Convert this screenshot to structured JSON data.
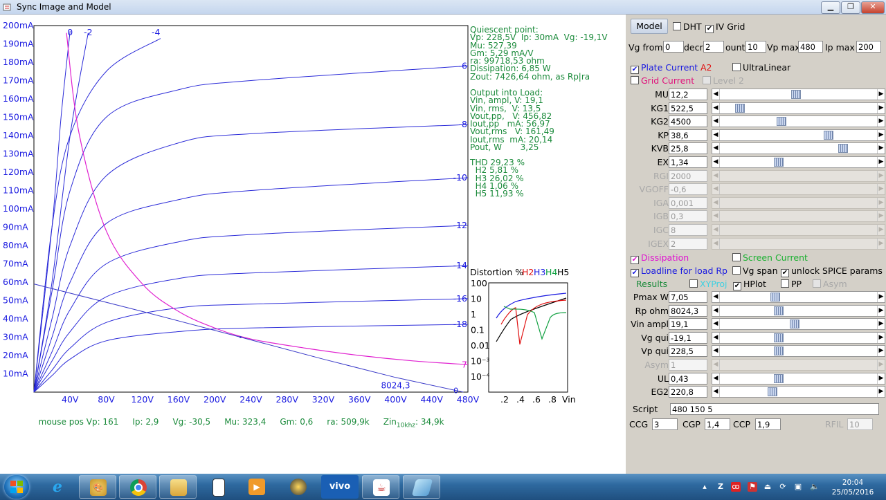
{
  "window": {
    "title": "Sync Image and Model",
    "buttons": {
      "minimize": "▁",
      "maximize": "❐",
      "close": "✕"
    }
  },
  "chart_data": {
    "type": "line",
    "title": "",
    "xlabel": "",
    "ylabel": "",
    "xlim": [
      0,
      480
    ],
    "ylim": [
      0,
      200
    ],
    "x_ticks": [
      "40V",
      "80V",
      "120V",
      "160V",
      "200V",
      "240V",
      "280V",
      "320V",
      "360V",
      "400V",
      "440V",
      "480V"
    ],
    "y_ticks": [
      "10mA",
      "20mA",
      "30mA",
      "40mA",
      "50mA",
      "60mA",
      "70mA",
      "80mA",
      "90mA",
      "100mA",
      "110mA",
      "120mA",
      "130mA",
      "140mA",
      "150mA",
      "160mA",
      "170mA",
      "180mA",
      "190mA",
      "200mA"
    ],
    "grid": false,
    "colors": {
      "curves": "#2a2ad8",
      "dissipation": "#e020d0",
      "loadline": "#3a3ac8"
    },
    "series": [
      {
        "name": "0",
        "x": [
          0,
          20,
          30,
          40
        ],
        "y": [
          0,
          90,
          150,
          197
        ]
      },
      {
        "name": "-2",
        "x": [
          0,
          20,
          40,
          60
        ],
        "y": [
          0,
          60,
          140,
          196
        ]
      },
      {
        "name": "-4",
        "x": [
          0,
          20,
          40,
          80,
          140
        ],
        "y": [
          0,
          90,
          140,
          175,
          193
        ]
      },
      {
        "name": "-6",
        "x": [
          0,
          20,
          40,
          80,
          160,
          240,
          480
        ],
        "y": [
          0,
          55,
          110,
          150,
          165,
          170,
          178
        ]
      },
      {
        "name": "-8",
        "x": [
          0,
          20,
          40,
          80,
          160,
          240,
          480
        ],
        "y": [
          0,
          40,
          80,
          118,
          136,
          141,
          146
        ]
      },
      {
        "name": "-10",
        "x": [
          0,
          20,
          40,
          80,
          160,
          240,
          480
        ],
        "y": [
          0,
          30,
          60,
          92,
          105,
          110,
          117
        ]
      },
      {
        "name": "-12",
        "x": [
          0,
          20,
          40,
          80,
          160,
          240,
          480
        ],
        "y": [
          0,
          22,
          45,
          70,
          82,
          86,
          91
        ]
      },
      {
        "name": "-14",
        "x": [
          0,
          20,
          40,
          80,
          160,
          240,
          480
        ],
        "y": [
          0,
          17,
          33,
          52,
          62,
          65,
          69
        ]
      },
      {
        "name": "-16",
        "x": [
          0,
          20,
          40,
          80,
          160,
          240,
          480
        ],
        "y": [
          0,
          12,
          24,
          38,
          46,
          48,
          51
        ]
      },
      {
        "name": "-18",
        "x": [
          0,
          20,
          40,
          80,
          160,
          240,
          480
        ],
        "y": [
          0,
          9,
          18,
          28,
          33,
          35,
          37
        ]
      }
    ],
    "dissipation": {
      "x": [
        36,
        50,
        80,
        120,
        160,
        200,
        240,
        300,
        360,
        420,
        480
      ],
      "y": [
        196,
        141,
        88,
        59,
        44,
        35,
        29,
        24,
        20,
        17,
        15
      ]
    },
    "loadline": {
      "x": [
        0,
        120,
        228.5,
        320,
        400,
        475
      ],
      "y": [
        59,
        44,
        30,
        18,
        8,
        0
      ],
      "label": "8024,3"
    },
    "curve_end_labels": [
      "-6",
      "-8",
      "-10",
      "-12",
      "-14",
      "-16",
      "-18"
    ],
    "dissipation_end_label": "7",
    "zero_label": "0",
    "top_labels": [
      "0",
      "-2",
      "-4"
    ],
    "quiescent": {
      "x": 228.5,
      "y": 30
    }
  },
  "distortion_chart": {
    "title": "Distortion %",
    "legend": [
      {
        "name": "H2",
        "color": "#e01010"
      },
      {
        "name": "H3",
        "color": "#1a1ae0"
      },
      {
        "name": "H4",
        "color": "#10a040"
      },
      {
        "name": "H5",
        "color": "#000000"
      }
    ],
    "y_ticks": [
      "100",
      "10",
      "1",
      "0.1",
      "0.01",
      "10⁻³",
      "10⁻⁴"
    ],
    "x_ticks": [
      ".2",
      ".4",
      ".6",
      ".8"
    ],
    "x_unit": "Vin"
  },
  "quiescent": {
    "heading": "Quiescent point:",
    "lines": [
      "Vp: 228,5V  Ip: 30mA  Vg: -19,1V",
      "Mu: 527,39",
      "Gm: 5,29 mA/V",
      "ra: 99718,53 ohm",
      "Dissipation: 6,85 W",
      "Zout: 7426,64 ohm, as Rp|ra"
    ]
  },
  "output": {
    "heading": "Output into Load:",
    "lines": [
      "Vin, ampl, V: 19,1",
      "Vin, rms,  V: 13,5",
      "Vout,pp,   V: 456,82",
      "Iout,pp   mA: 56,97",
      "Vout,rms   V: 161,49",
      "Iout,rms  mA: 20,14",
      "Pout, W       3,25"
    ]
  },
  "thd": {
    "heading": "THD 29,23 %",
    "lines": [
      "  H2 5,81 %",
      "  H3 26,02 %",
      "  H4 1,06 %",
      "  H5 11,93 %"
    ]
  },
  "mouse": {
    "vp": "mouse pos Vp: 161",
    "ip": "Ip: 2,9",
    "vg": "Vg: -30,5",
    "mu": "Mu: 323,4",
    "gm": "Gm: 0,6",
    "ra": "ra: 509,9k",
    "zin": "Zin",
    "zin_sub": "10khz",
    "zin_val": ": 34,9k"
  },
  "panel": {
    "model_button": "Model",
    "dht": "DHT",
    "iv_grid": "IV Grid",
    "vg_from_label": "Vg from",
    "vg_from": "0",
    "decr_label": "decr",
    "decr": "2",
    "count_label": "ount",
    "count": "10",
    "vpmax_label": "Vp max",
    "vpmax": "480",
    "ipmax_label": "Ip max",
    "ipmax": "200",
    "plate_current": "Plate Current",
    "a2": "A2",
    "ultralinear": "UltraLinear",
    "grid_current": "Grid Current",
    "level2": "Level 2",
    "params": [
      {
        "label": "MU",
        "value": "12,2",
        "pos": 0.48,
        "enabled": true
      },
      {
        "label": "KG1",
        "value": "522,5",
        "pos": 0.1,
        "enabled": true
      },
      {
        "label": "KG2",
        "value": "4500",
        "pos": 0.38,
        "enabled": true
      },
      {
        "label": "KP",
        "value": "38,6",
        "pos": 0.7,
        "enabled": true
      },
      {
        "label": "KVB",
        "value": "25,8",
        "pos": 0.8,
        "enabled": true
      },
      {
        "label": "EX",
        "value": "1,34",
        "pos": 0.36,
        "enabled": true
      },
      {
        "label": "RGI",
        "value": "2000",
        "pos": null,
        "enabled": false
      },
      {
        "label": "VGOFF",
        "value": "-0,6",
        "pos": null,
        "enabled": false
      },
      {
        "label": "IGA",
        "value": "0,001",
        "pos": null,
        "enabled": false
      },
      {
        "label": "IGB",
        "value": "0,3",
        "pos": null,
        "enabled": false
      },
      {
        "label": "IGC",
        "value": "8",
        "pos": null,
        "enabled": false
      },
      {
        "label": "IGEX",
        "value": "2",
        "pos": null,
        "enabled": false
      }
    ],
    "dissipation": "Dissipation",
    "screen_current": "Screen Current",
    "loadline": "Loadline for load Rp",
    "vg_span": "Vg span",
    "unlock_spice": "unlock SPICE params",
    "results": "Results",
    "xyproj": "XYProj",
    "hplot": "HPlot",
    "pp": "PP",
    "asym_chk": "Asym",
    "params2": [
      {
        "label": "Pmax W",
        "value": "7,05",
        "pos": 0.34,
        "enabled": true
      },
      {
        "label": "Rp ohm",
        "value": "8024,3",
        "pos": 0.36,
        "enabled": true
      },
      {
        "label": "Vin ampl",
        "value": "19,1",
        "pos": 0.47,
        "enabled": true
      },
      {
        "label": "Vg qui",
        "value": "-19,1",
        "pos": 0.36,
        "enabled": true
      },
      {
        "label": "Vp qui",
        "value": "228,5",
        "pos": 0.36,
        "enabled": true
      },
      {
        "label": "Asym",
        "value": "1",
        "pos": null,
        "enabled": false
      },
      {
        "label": "UL",
        "value": "0,43",
        "pos": 0.36,
        "enabled": true
      },
      {
        "label": "EG2",
        "value": "220,8",
        "pos": 0.32,
        "enabled": true
      }
    ],
    "script_label": "Script",
    "script": "480 150 5",
    "ccg_label": "CCG",
    "ccg": "3",
    "cgp_label": "CGP",
    "cgp": "1,4",
    "ccp_label": "CCP",
    "ccp": "1,9",
    "rfil_label": "RFIL",
    "rfil": "10"
  },
  "taskbar": {
    "apps": [
      "start",
      "internet-explorer",
      "paint",
      "chrome",
      "file-explorer",
      "notepad",
      "media-player",
      "game",
      "vivo",
      "java",
      "app"
    ],
    "vivo_label": "vivo",
    "time": "20:04",
    "date": "25/05/2016"
  }
}
